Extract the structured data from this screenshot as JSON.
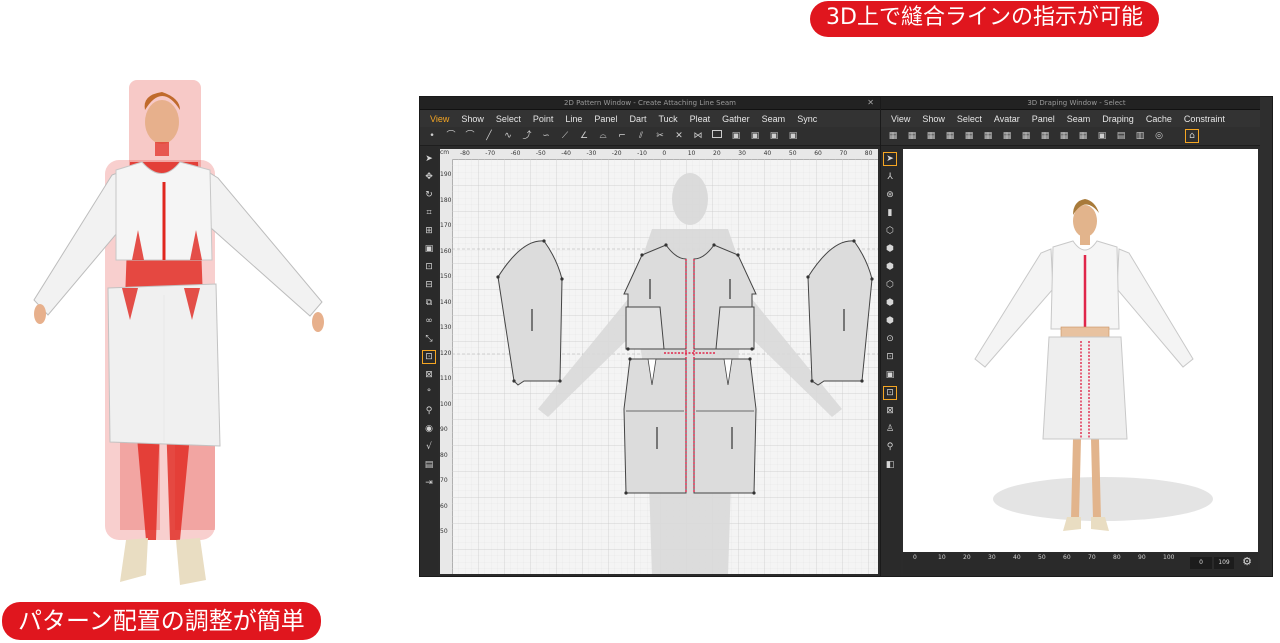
{
  "badges": {
    "top": "3D上で縫合ラインの指示が可能",
    "bottom": "パターン配置の調整が簡単"
  },
  "colors": {
    "badge_red": "#e0161e",
    "accent_orange": "#f5a623",
    "seam_red": "#e0264a",
    "garment_white": "#eeeeee",
    "pattern_piece": "#dcdcdc"
  },
  "pattern_window": {
    "title": "2D Pattern Window - Create Attaching Line Seam",
    "menu": [
      "View",
      "Show",
      "Select",
      "Point",
      "Line",
      "Panel",
      "Dart",
      "Tuck",
      "Pleat",
      "Gather",
      "Seam",
      "Sync"
    ],
    "active_menu": "View",
    "ruler_unit": "cm",
    "h_ruler_ticks": [
      "-80",
      "-70",
      "-60",
      "-50",
      "-40",
      "-30",
      "-20",
      "-10",
      "0",
      "10",
      "20",
      "30",
      "40",
      "50",
      "60",
      "70",
      "80"
    ],
    "v_ruler_ticks": [
      "190",
      "180",
      "170",
      "160",
      "150",
      "140",
      "130",
      "120",
      "110",
      "100",
      "90",
      "80",
      "70",
      "60",
      "50"
    ]
  },
  "draping_window": {
    "title": "3D Draping Window - Select",
    "menu": [
      "View",
      "Show",
      "Select",
      "Avatar",
      "Panel",
      "Seam",
      "Draping",
      "Cache",
      "Constraint"
    ],
    "timeline_ticks": [
      "0",
      "10",
      "20",
      "30",
      "40",
      "50",
      "60",
      "70",
      "80",
      "90",
      "100"
    ],
    "frame_start": "0",
    "frame_end": "109"
  },
  "icons": {
    "close": "close-icon",
    "settings": "gear-icon",
    "home": "home-icon"
  }
}
